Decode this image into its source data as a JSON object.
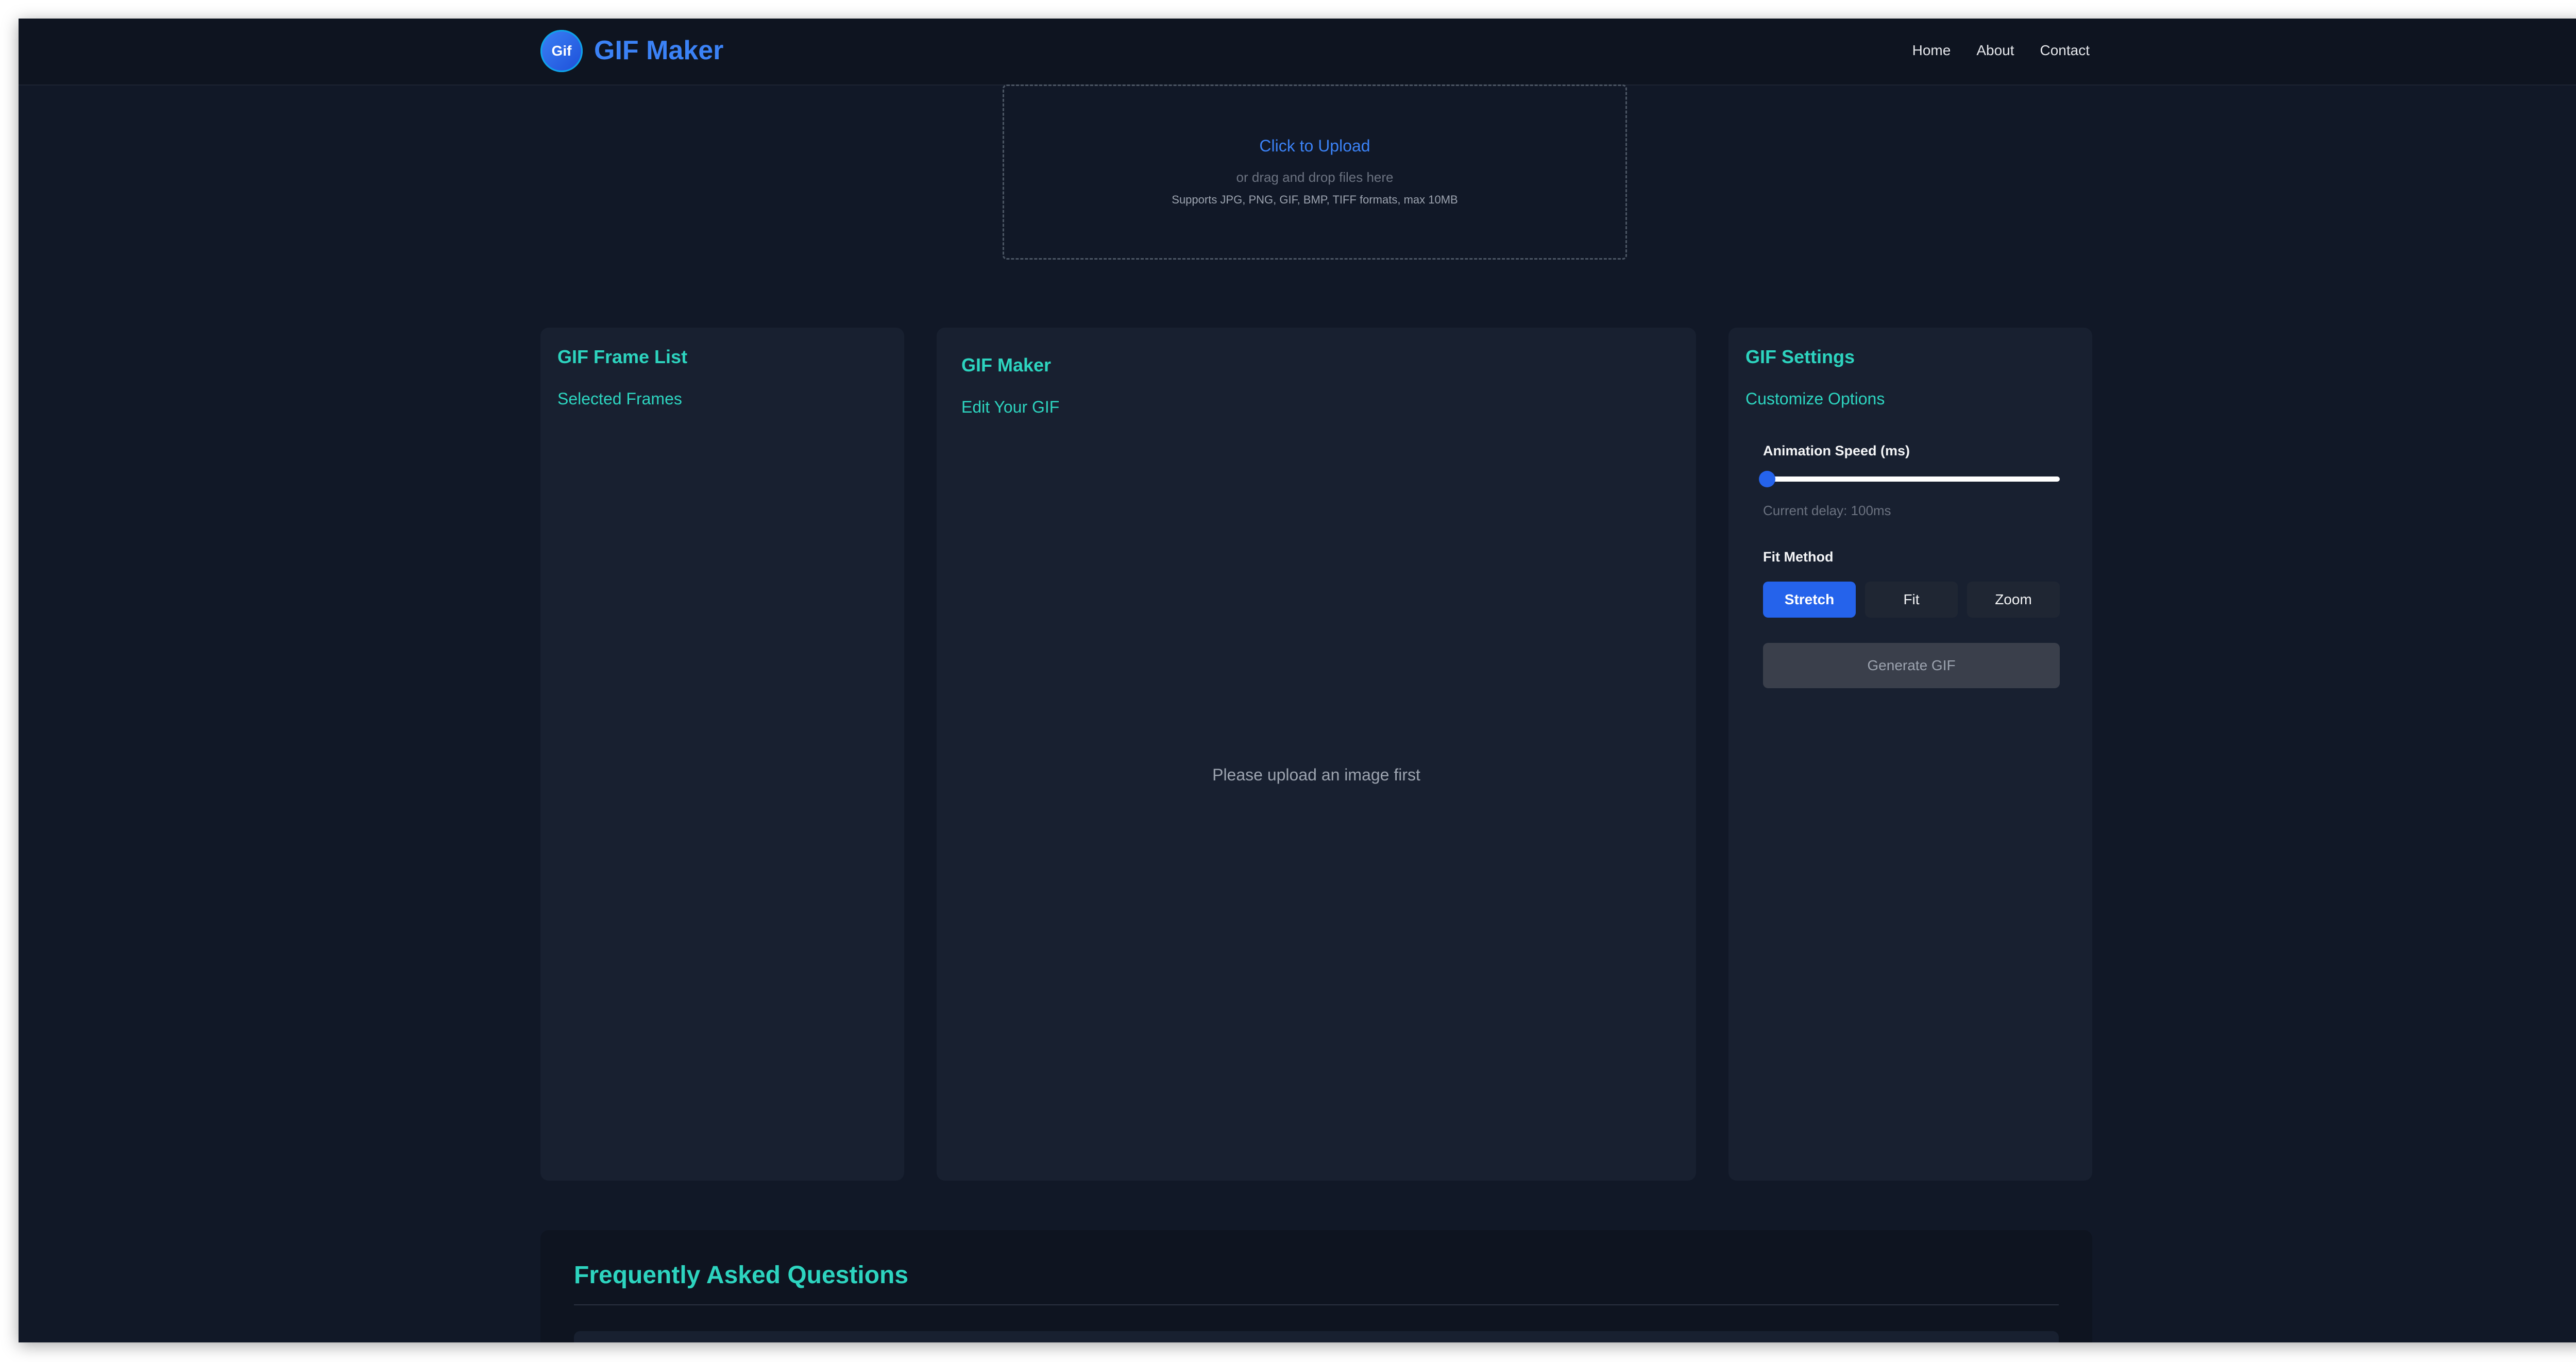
{
  "header": {
    "logo_text": "Gif",
    "brand": "GIF Maker",
    "nav": [
      "Home",
      "About",
      "Contact"
    ]
  },
  "upload": {
    "title": "Click to Upload",
    "subtitle": "or drag and drop files here",
    "formats": "Supports JPG, PNG, GIF, BMP, TIFF formats, max 10MB"
  },
  "frame_list": {
    "title": "GIF Frame List",
    "subtitle": "Selected Frames"
  },
  "maker": {
    "title": "GIF Maker",
    "subtitle": "Edit Your GIF",
    "empty_message": "Please upload an image first"
  },
  "settings": {
    "title": "GIF Settings",
    "subtitle": "Customize Options",
    "speed_label": "Animation Speed (ms)",
    "speed_value_fraction": 0.0,
    "delay_text": "Current delay: 100ms",
    "fit_label": "Fit Method",
    "fit_options": [
      "Stretch",
      "Fit",
      "Zoom"
    ],
    "fit_selected": "Stretch",
    "generate_label": "Generate GIF"
  },
  "faq": {
    "title": "Frequently Asked Questions"
  },
  "colors": {
    "accent": "#2563eb",
    "teal": "#2dd4bf",
    "background": "#111827",
    "panel": "#182030"
  }
}
